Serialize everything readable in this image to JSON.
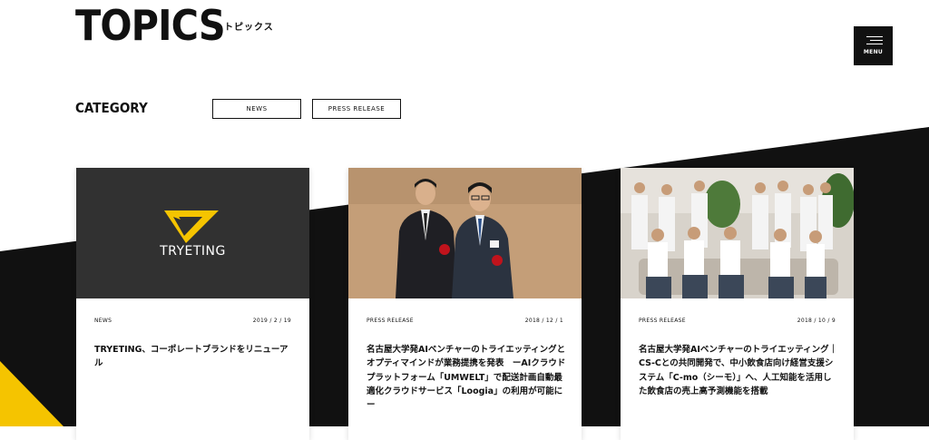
{
  "header": {
    "title": "TOPICS",
    "subtitle": "トピックス",
    "menu_label": "MENU"
  },
  "category": {
    "label": "CATEGORY",
    "buttons": [
      "NEWS",
      "PRESS RELEASE"
    ]
  },
  "logo_text": "TRYETING",
  "cards": [
    {
      "category": "NEWS",
      "date": "2019 / 2 / 19",
      "title": "TRYETING、コーポレートブランドをリニューアル"
    },
    {
      "category": "PRESS RELEASE",
      "date": "2018 / 12 / 1",
      "title": "名古屋大学発AIベンチャーのトライエッティングとオプティマインドが業務提携を発表　ーAIクラウドプラットフォーム「UMWELT」で配送計画自動最適化クラウドサービス「Loogia」の利用が可能にー"
    },
    {
      "category": "PRESS RELEASE",
      "date": "2018 / 10 / 9",
      "title": "名古屋大学発AIベンチャーのトライエッティング｜CS-Cとの共同開発で、中小飲食店向け経営支援システム「C-mo（シーモ）」へ、人工知能を活用した飲食店の売上高予測機能を搭載"
    }
  ],
  "colors": {
    "dark": "#111111",
    "yellow": "#f5c400",
    "logo_bg": "#313131",
    "logo_mark": "#f5c400"
  }
}
